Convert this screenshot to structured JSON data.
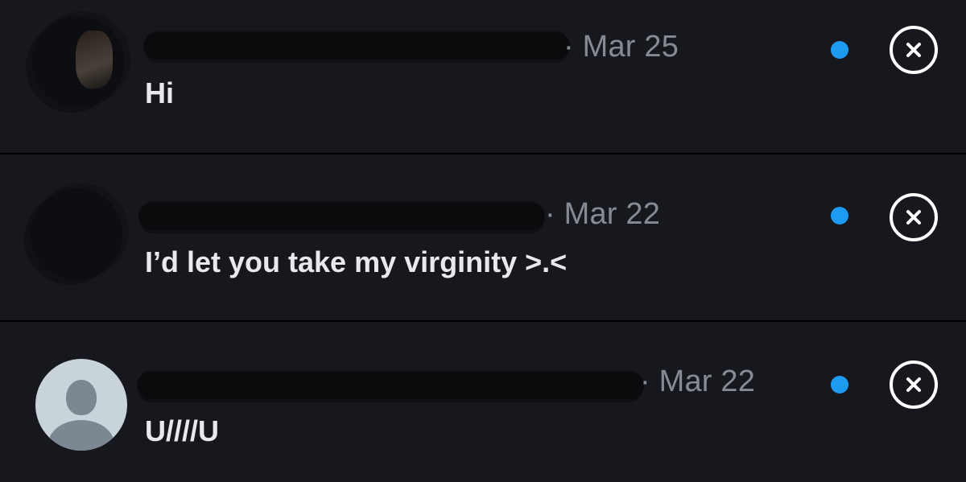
{
  "colors": {
    "background": "#17181d",
    "divider": "#000000",
    "message_text": "#e7e9ea",
    "date_text": "#858b93",
    "unread_dot": "#1d9bf0",
    "close_icon": "#ffffff"
  },
  "conversations": [
    {
      "separator_date": "· Mar 25",
      "message": "Hi",
      "unread": true,
      "avatar": "redacted-photo",
      "close_icon": "close-icon"
    },
    {
      "separator_date": "· Mar 22",
      "message": "I’d let you take my virginity >.<",
      "unread": true,
      "avatar": "redacted-photo",
      "close_icon": "close-icon"
    },
    {
      "separator_date": "· Mar 22",
      "message": "U////U",
      "unread": true,
      "avatar": "default-profile-icon",
      "close_icon": "close-icon"
    }
  ]
}
